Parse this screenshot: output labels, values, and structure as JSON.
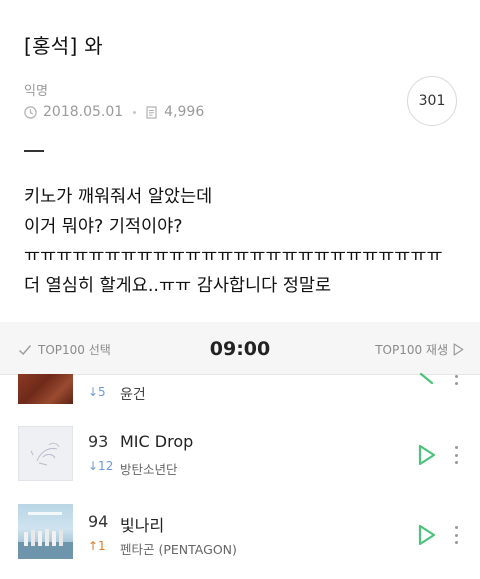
{
  "post": {
    "title": "[홍석] 와",
    "author": "익명",
    "date": "2018.05.01",
    "views": "4,996",
    "comment_count": "301",
    "lines": [
      "키노가 깨워줘서 알았는데",
      "이거 뭐야? 기적이야?",
      "ㅠㅠㅠㅠㅠㅠㅠㅠㅠㅠㅠㅠㅠㅠㅠㅠㅠㅠㅠㅠㅠㅠㅠㅠㅠㅠ",
      "더 열심히 할게요..ㅠㅠ 감사합니다 정말로"
    ]
  },
  "chart_app": {
    "select_label": "TOP100 선택",
    "time": "09:00",
    "play_label": "TOP100 재생",
    "accent_color": "#4cc27a",
    "items": [
      {
        "rank": "",
        "change": "↓5",
        "change_dir": "down",
        "title": "",
        "artist": "윤건"
      },
      {
        "rank": "93",
        "change": "↓12",
        "change_dir": "down",
        "title": "MIC Drop",
        "artist": "방탄소년단"
      },
      {
        "rank": "94",
        "change": "↑1",
        "change_dir": "up",
        "title": "빛나리",
        "artist": "펜타곤 (PENTAGON)"
      }
    ]
  }
}
